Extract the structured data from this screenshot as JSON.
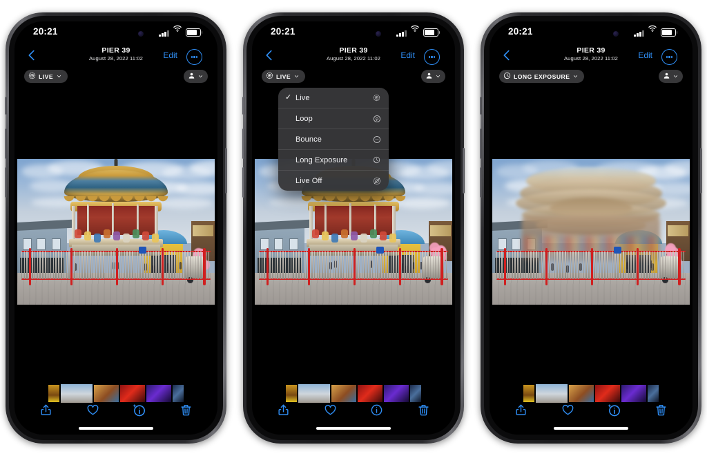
{
  "meta": {
    "accent_blue": "#2f8ef5",
    "chip_bg": "#3c3c3e",
    "menu_bg": "#373739"
  },
  "phones": [
    {
      "id": "phone-live",
      "status": {
        "time": "20:21",
        "signal": "cellular-bars-icon",
        "wifi": "wifi-icon",
        "battery": "battery-icon"
      },
      "nav": {
        "back": "chevron-left-icon",
        "title": "PIER 39",
        "subtitle": "August 28, 2022  11:02",
        "edit": "Edit",
        "more": "ellipsis-circle-icon"
      },
      "chip": {
        "icon": "live-photo-icon",
        "label": "LIVE",
        "chevron": "chevron-down-icon"
      },
      "person_chip": {
        "icon": "person-icon",
        "chevron": "chevron-down-icon"
      },
      "photo_mode": "sharp",
      "menu_open": false,
      "toolbar": [
        {
          "name": "share-button",
          "icon": "share-icon"
        },
        {
          "name": "favorite-button",
          "icon": "heart-icon"
        },
        {
          "name": "info-button",
          "icon": "info-sparkle-icon"
        },
        {
          "name": "delete-button",
          "icon": "trash-icon"
        }
      ]
    },
    {
      "id": "phone-menu",
      "status": {
        "time": "20:21",
        "signal": "cellular-bars-icon",
        "wifi": "wifi-icon",
        "battery": "battery-icon"
      },
      "nav": {
        "back": "chevron-left-icon",
        "title": "PIER 39",
        "subtitle": "August 28, 2022  11:02",
        "edit": "Edit",
        "more": "ellipsis-circle-icon"
      },
      "chip": {
        "icon": "live-photo-icon",
        "label": "LIVE",
        "chevron": "chevron-down-icon"
      },
      "person_chip": {
        "icon": "person-icon",
        "chevron": "chevron-down-icon"
      },
      "photo_mode": "sharp",
      "menu_open": true,
      "toolbar": [
        {
          "name": "share-button",
          "icon": "share-icon"
        },
        {
          "name": "favorite-button",
          "icon": "heart-icon"
        },
        {
          "name": "info-button",
          "icon": "info-icon"
        },
        {
          "name": "delete-button",
          "icon": "trash-icon"
        }
      ]
    },
    {
      "id": "phone-longexposure",
      "status": {
        "time": "20:21",
        "signal": "cellular-bars-icon",
        "wifi": "wifi-icon",
        "battery": "battery-icon"
      },
      "nav": {
        "back": "chevron-left-icon",
        "title": "PIER 39",
        "subtitle": "August 28, 2022  11:02",
        "edit": "Edit",
        "more": "ellipsis-circle-icon"
      },
      "chip": {
        "icon": "long-exposure-icon",
        "label": "LONG EXPOSURE",
        "chevron": "chevron-down-icon"
      },
      "person_chip": {
        "icon": "person-icon",
        "chevron": "chevron-down-icon"
      },
      "photo_mode": "longexposure",
      "menu_open": false,
      "toolbar": [
        {
          "name": "share-button",
          "icon": "share-icon"
        },
        {
          "name": "favorite-button",
          "icon": "heart-icon"
        },
        {
          "name": "info-button",
          "icon": "info-sparkle-icon"
        },
        {
          "name": "delete-button",
          "icon": "trash-icon"
        }
      ]
    }
  ],
  "live_menu": {
    "items": [
      {
        "label": "Live",
        "checked": true,
        "icon": "live-photo-icon"
      },
      {
        "label": "Loop",
        "checked": false,
        "icon": "loop-icon"
      },
      {
        "label": "Bounce",
        "checked": false,
        "icon": "bounce-icon"
      },
      {
        "label": "Long Exposure",
        "checked": false,
        "icon": "long-exposure-icon"
      },
      {
        "label": "Live Off",
        "checked": false,
        "icon": "live-off-icon"
      }
    ],
    "check_glyph": "✓"
  },
  "thumbnails": [
    {
      "name": "thumb-1",
      "kind": "narrow-warm"
    },
    {
      "name": "thumb-2",
      "kind": "carousel-sharp"
    },
    {
      "name": "thumb-3",
      "kind": "carousel-warm"
    },
    {
      "name": "thumb-4",
      "kind": "red"
    },
    {
      "name": "thumb-5",
      "kind": "purple"
    },
    {
      "name": "thumb-6",
      "kind": "blue-night"
    }
  ]
}
